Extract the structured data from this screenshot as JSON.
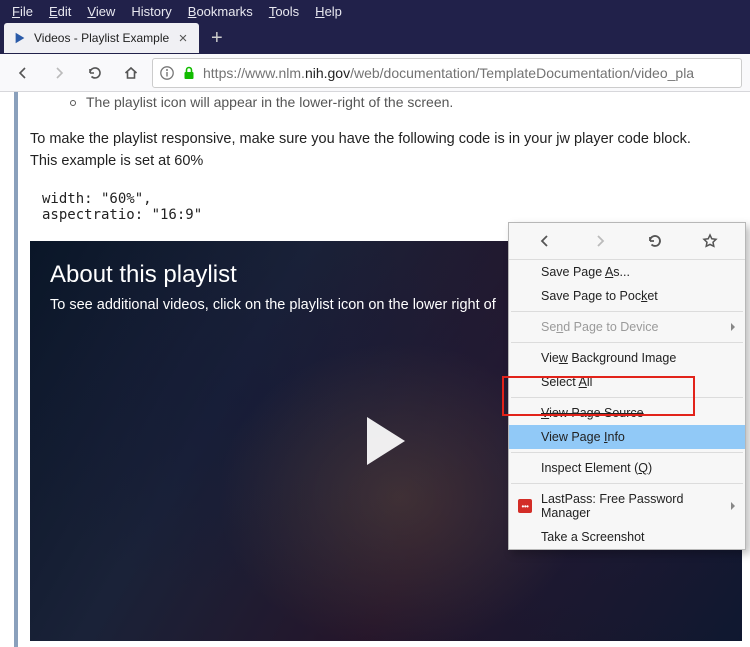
{
  "menubar": {
    "items": [
      {
        "label": "File",
        "accel": "F"
      },
      {
        "label": "Edit",
        "accel": "E"
      },
      {
        "label": "View",
        "accel": "V"
      },
      {
        "label": "History",
        "accel": ""
      },
      {
        "label": "Bookmarks",
        "accel": "B"
      },
      {
        "label": "Tools",
        "accel": "T"
      },
      {
        "label": "Help",
        "accel": "H"
      }
    ]
  },
  "tab": {
    "title": "Videos - Playlist Example"
  },
  "url": {
    "scheme": "https://",
    "host_pre": "www.nlm.",
    "host_dom": "nih.gov",
    "path": "/web/documentation/TemplateDocumentation/video_pla"
  },
  "page": {
    "truncated_bullet": "The playlist icon will appear in the lower-right of the screen.",
    "para_line1": "To make the playlist responsive, make sure you have the following code is in your jw player code block.",
    "para_line2": "This example is set at 60%",
    "code_line1": "width: \"60%\",",
    "code_line2": "aspectratio: \"16:9\""
  },
  "video": {
    "title": "About this playlist",
    "desc": "To see additional videos, click on the playlist icon on the lower right of"
  },
  "context_menu": {
    "items": [
      {
        "label": "Save Page As...",
        "accel": "A",
        "arrow": false,
        "disabled": false,
        "hover": false
      },
      {
        "label": "Save Page to Pocket",
        "accel": "k",
        "arrow": false,
        "disabled": false,
        "hover": false
      },
      {
        "sep": true
      },
      {
        "label": "Send Page to Device",
        "accel": "n",
        "arrow": true,
        "disabled": true,
        "hover": false
      },
      {
        "sep": true
      },
      {
        "label": "View Background Image",
        "accel": "w",
        "arrow": false,
        "disabled": false,
        "hover": false
      },
      {
        "label": "Select All",
        "accel": "A",
        "arrow": false,
        "disabled": false,
        "hover": false
      },
      {
        "sep": true
      },
      {
        "label": "View Page Source",
        "accel": "V",
        "arrow": false,
        "disabled": false,
        "hover": false,
        "strike": true
      },
      {
        "label": "View Page Info",
        "accel": "I",
        "arrow": false,
        "disabled": false,
        "hover": true
      },
      {
        "sep": true
      },
      {
        "label": "Inspect Element (Q)",
        "accel": "Q",
        "arrow": false,
        "disabled": false,
        "hover": false
      },
      {
        "sep": true
      },
      {
        "label": "LastPass: Free Password Manager",
        "accel": "",
        "arrow": true,
        "disabled": false,
        "hover": false,
        "icon": "lastpass"
      },
      {
        "label": "Take a Screenshot",
        "accel": "",
        "arrow": false,
        "disabled": false,
        "hover": false
      }
    ]
  }
}
